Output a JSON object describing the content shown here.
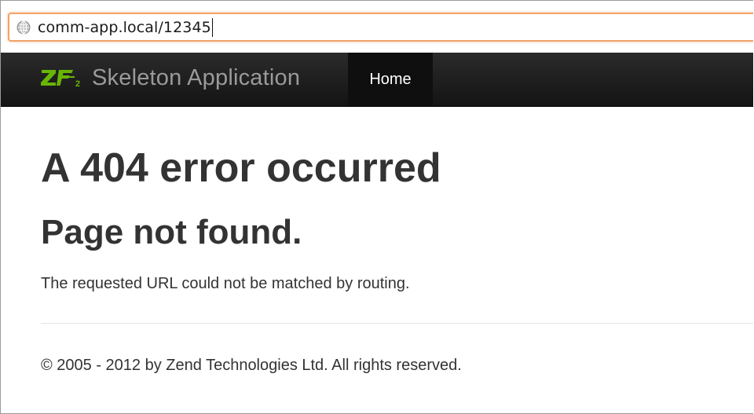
{
  "browser": {
    "url": "comm-app.local/12345",
    "globe_icon": "globe-icon"
  },
  "navbar": {
    "brand_logo": "ZF2",
    "brand_text": "Skeleton Application",
    "home_label": "Home"
  },
  "main": {
    "heading": "A 404 error occurred",
    "subheading": "Page not found.",
    "message": "The requested URL could not be matched by routing."
  },
  "footer": {
    "copyright": "© 2005 - 2012 by Zend Technologies Ltd. All rights reserved."
  },
  "colors": {
    "navbar_bg": "#1b1b1b",
    "brand_green": "#68b604",
    "heading_text": "#333333",
    "url_focus_border": "#f0a36a"
  }
}
